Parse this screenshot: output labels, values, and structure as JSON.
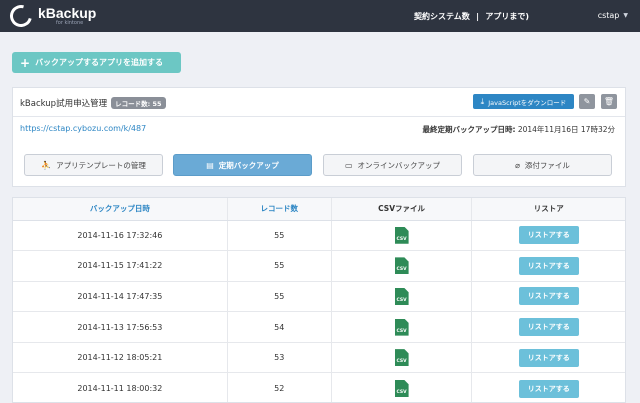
{
  "header": {
    "logo_title": "kBackup",
    "logo_sub": "for kintone",
    "contract_label": "契約システム数",
    "contract_count": "|",
    "contract_suffix": "アプリまで)",
    "user_name": "cstap"
  },
  "add_button": {
    "label": "バックアップするアプリを追加する"
  },
  "app": {
    "name": "kBackup試用申込管理",
    "record_badge": "レコード数: 55",
    "js_download_label": "JavaScriptをダウンロード",
    "url": "https://cstap.cybozu.com/k/487",
    "last_backup_label": "最終定期バックアップ日時:",
    "last_backup_value": "2014年11月16日 17時32分"
  },
  "tabs": [
    {
      "label": "アプリテンプレートの管理",
      "icon": "people-icon",
      "active": false
    },
    {
      "label": "定期バックアップ",
      "icon": "database-icon",
      "active": true
    },
    {
      "label": "オンラインバックアップ",
      "icon": "monitor-icon",
      "active": false
    },
    {
      "label": "添付ファイル",
      "icon": "paperclip-icon",
      "active": false
    }
  ],
  "table": {
    "headers": [
      "バックアップ日時",
      "レコード数",
      "CSVファイル",
      "リストア"
    ],
    "csv_icon_label": "CSV",
    "rows": [
      {
        "datetime": "2014-11-16 17:32:46",
        "records": "55",
        "restore": "リストアする"
      },
      {
        "datetime": "2014-11-15 17:41:22",
        "records": "55",
        "restore": "リストアする"
      },
      {
        "datetime": "2014-11-14 17:47:35",
        "records": "55",
        "restore": "リストアする"
      },
      {
        "datetime": "2014-11-13 17:56:53",
        "records": "54",
        "restore": "リストアする"
      },
      {
        "datetime": "2014-11-12 18:05:21",
        "records": "53",
        "restore": "リストアする"
      },
      {
        "datetime": "2014-11-11 18:00:32",
        "records": "52",
        "restore": "リストアする"
      }
    ]
  },
  "colors": {
    "topbar": "#2e3440",
    "add_button": "#6cc7c4",
    "primary": "#2d86c4",
    "tab_active": "#6aaad6",
    "restore_button": "#6cc0da",
    "csv_icon": "#2e8b57"
  }
}
